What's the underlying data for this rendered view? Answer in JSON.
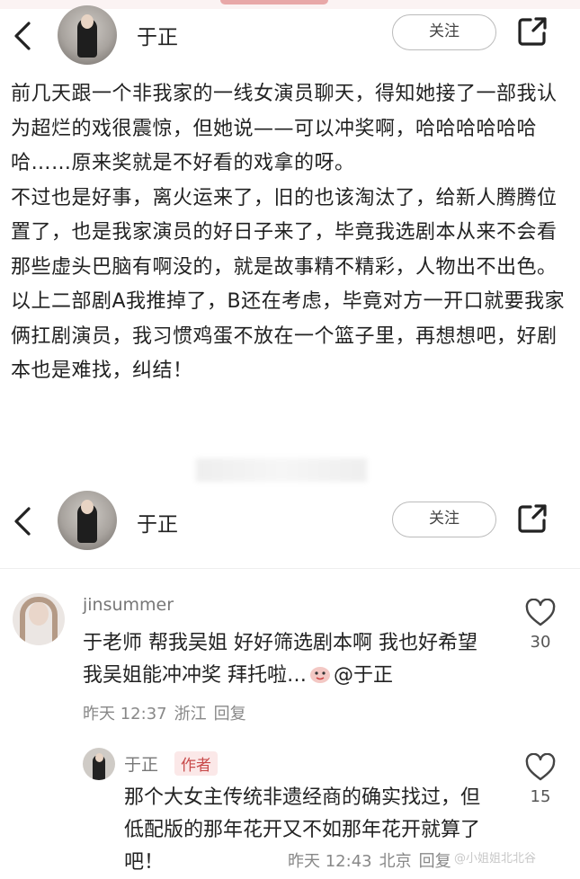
{
  "header": {
    "username": "于正",
    "follow_label": "关注"
  },
  "post": {
    "paragraphs": [
      "前几天跟一个非我家的一线女演员聊天，得知她接了一部我认为超烂的戏很震惊，但她说——可以冲奖啊，哈哈哈哈哈哈哈……原来奖就是不好看的戏拿的呀。",
      "不过也是好事，离火运来了，旧的也该淘汰了，给新人腾腾位置了，也是我家演员的好日子来了，毕竟我选剧本从来不会看那些虚头巴脑有啊没的，就是故事精不精彩，人物出不出色。",
      "以上二部剧A我推掉了，B还在考虑，毕竟对方一开口就要我家俩扛剧演员，我习惯鸡蛋不放在一个篮子里，再想想吧，好剧本也是难找，纠结！"
    ]
  },
  "comments": [
    {
      "user": "jinsummer",
      "text": "于老师 帮我吴姐 好好筛选剧本啊 我也好希望 我吴姐能冲冲奖 拜托啦…",
      "mention": "@于正",
      "time": "昨天 12:37",
      "location": "浙江",
      "reply_label": "回复",
      "likes": "30"
    },
    {
      "user": "于正",
      "badge": "作者",
      "text": "那个大女主传统非遗经商的确实找过，但低配版的那年花开又不如那年花开就算了吧！",
      "time": "昨天 12:43",
      "location": "北京",
      "reply_label": "回复",
      "likes": "15"
    }
  ],
  "watermark": "@小姐姐北北谷",
  "colors": {
    "author_badge": "#c84a4a",
    "top_strip": "#e8a8a8"
  }
}
